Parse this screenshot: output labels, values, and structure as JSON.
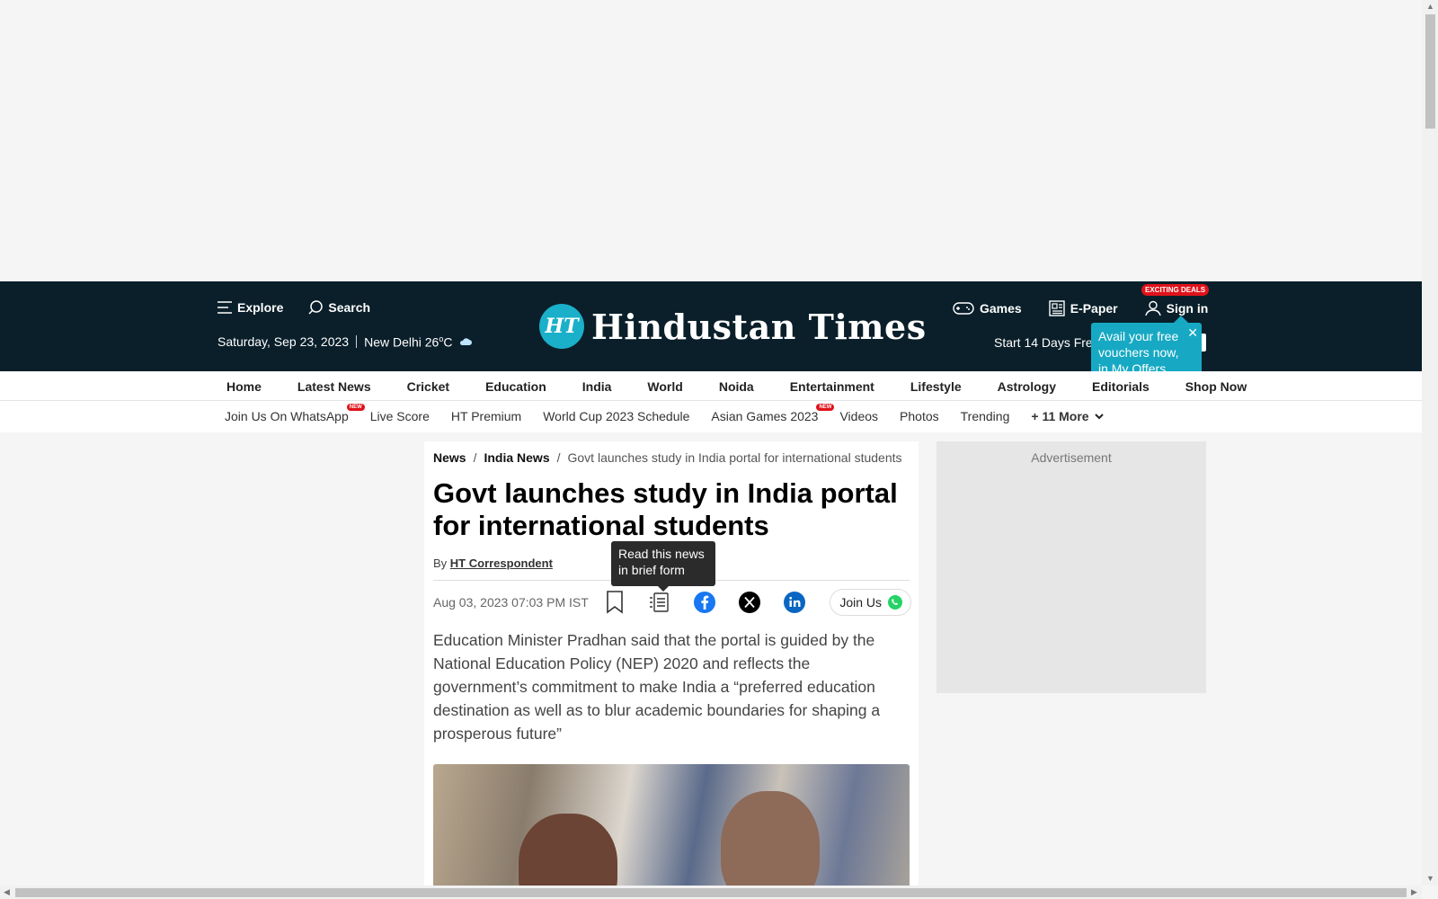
{
  "header": {
    "explore": "Explore",
    "search": "Search",
    "date": "Saturday, Sep 23, 2023",
    "location_weather": "New Delhi 26",
    "degree": "o",
    "unit": "C",
    "logo_badge": "HT",
    "logo_text": "Hindustan Times",
    "games": "Games",
    "epaper": "E-Paper",
    "sign_in": "Sign in",
    "deals_badge": "EXCITING DEALS",
    "start_trial": "Start 14 Days Fre"
  },
  "offer_popover": {
    "text": "Avail your free vouchers now, in My Offers",
    "close": "✕"
  },
  "nav_primary": [
    "Home",
    "Latest News",
    "Cricket",
    "Education",
    "India",
    "World",
    "Noida",
    "Entertainment",
    "Lifestyle",
    "Astrology",
    "Editorials",
    "Shop Now"
  ],
  "nav_secondary": [
    {
      "label": "Join Us On WhatsApp",
      "badge": "NEW"
    },
    {
      "label": "Live Score",
      "badge": ""
    },
    {
      "label": "HT Premium",
      "badge": ""
    },
    {
      "label": "World Cup 2023 Schedule",
      "badge": ""
    },
    {
      "label": "Asian Games 2023",
      "badge": "NEW"
    },
    {
      "label": "Videos",
      "badge": ""
    },
    {
      "label": "Photos",
      "badge": ""
    },
    {
      "label": "Trending",
      "badge": ""
    }
  ],
  "nav_more": "+ 11 More",
  "article": {
    "breadcrumb": [
      "News",
      "India News",
      "Govt launches study in India portal for international students"
    ],
    "breadcrumb_sep": "/",
    "headline": "Govt launches study in India portal for international students",
    "by": "By",
    "author": "HT Correspondent",
    "timestamp": "Aug 03, 2023 07:03 PM IST",
    "tooltip": "Read this news in brief form",
    "join_us": "Join Us",
    "summary": "Education Minister Pradhan said that the portal is guided by the National Education Policy (NEP) 2020 and reflects the government’s commitment to make India a “preferred education destination as well as to blur academic boundaries for shaping a prosperous future”"
  },
  "sidebar_ad": {
    "label": "Advertisement"
  },
  "colors": {
    "header_bg": "#0a1f2a",
    "accent": "#17a9c3",
    "badge_red": "#e0121a",
    "facebook": "#1877f2",
    "linkedin": "#0a66c2",
    "whatsapp": "#25d366"
  }
}
